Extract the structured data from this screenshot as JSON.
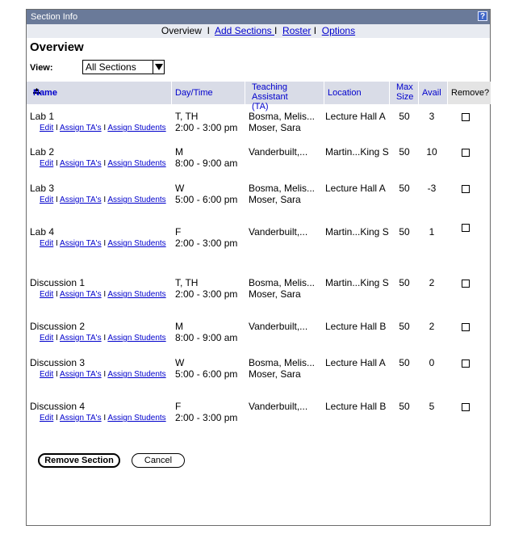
{
  "window": {
    "title": "Section Info",
    "help_label": "?"
  },
  "nav": {
    "overview": "Overview",
    "sep1": "I",
    "add_sections": "Add Sections ",
    "sep2": "I",
    "roster": "Roster",
    "sep3": "I",
    "options": "Options"
  },
  "page": {
    "heading": "Overview"
  },
  "view": {
    "label": "View:",
    "selected": "All Sections"
  },
  "table": {
    "headers": {
      "name": "Name",
      "daytime": "Day/Time",
      "ta_line1": "Teaching",
      "ta_line2": "Assistant (TA)",
      "location": "Location",
      "max_line1": "Max",
      "max_line2": "Size",
      "avail": "Avail",
      "remove": "Remove?"
    },
    "link_labels": {
      "edit": "Edit",
      "sep": "I",
      "assign_tas": "Assign TA's",
      "assign_students": "Assign Students"
    },
    "rows": [
      {
        "name": "Lab 1",
        "day": "T, TH",
        "time": "2:00 - 3:00 pm",
        "ta1": "Bosma, Melis...",
        "ta2": "Moser, Sara",
        "location": "Lecture Hall A",
        "max": "50",
        "avail": "3"
      },
      {
        "name": "Lab 2",
        "day": "M",
        "time": "8:00 - 9:00 am",
        "ta1": "Vanderbuilt,...",
        "ta2": "",
        "location": "Martin...King S",
        "max": "50",
        "avail": "10"
      },
      {
        "name": "Lab 3",
        "day": "W",
        "time": "5:00 - 6:00 pm",
        "ta1": "Bosma, Melis...",
        "ta2": "Moser, Sara",
        "location": "Lecture Hall A",
        "max": "50",
        "avail": "-3"
      },
      {
        "name": "Lab 4",
        "day": "F",
        "time": "2:00 - 3:00 pm",
        "ta1": "Vanderbuilt,...",
        "ta2": "",
        "location": "Martin...King S",
        "max": "50",
        "avail": "1"
      },
      {
        "name": "Discussion 1",
        "day": "T, TH",
        "time": "2:00 - 3:00 pm",
        "ta1": "Bosma, Melis...",
        "ta2": "Moser, Sara",
        "location": "Martin...King S",
        "max": "50",
        "avail": "2"
      },
      {
        "name": "Discussion 2",
        "day": "M",
        "time": "8:00 - 9:00 am",
        "ta1": "Vanderbuilt,...",
        "ta2": "",
        "location": "Lecture Hall B",
        "max": "50",
        "avail": "2"
      },
      {
        "name": "Discussion 3",
        "day": "W",
        "time": "5:00 - 6:00 pm",
        "ta1": "Bosma, Melis...",
        "ta2": "Moser, Sara",
        "location": "Lecture Hall A",
        "max": "50",
        "avail": "0"
      },
      {
        "name": "Discussion 4",
        "day": "F",
        "time": "2:00 - 3:00 pm",
        "ta1": "Vanderbuilt,...",
        "ta2": "",
        "location": "Lecture Hall B",
        "max": "50",
        "avail": "5"
      }
    ]
  },
  "buttons": {
    "remove_section": "Remove Section",
    "cancel": "Cancel"
  },
  "colors": {
    "titlebar": "#6a7a99",
    "header_bg": "#d9dce7",
    "link": "#0000cc"
  }
}
